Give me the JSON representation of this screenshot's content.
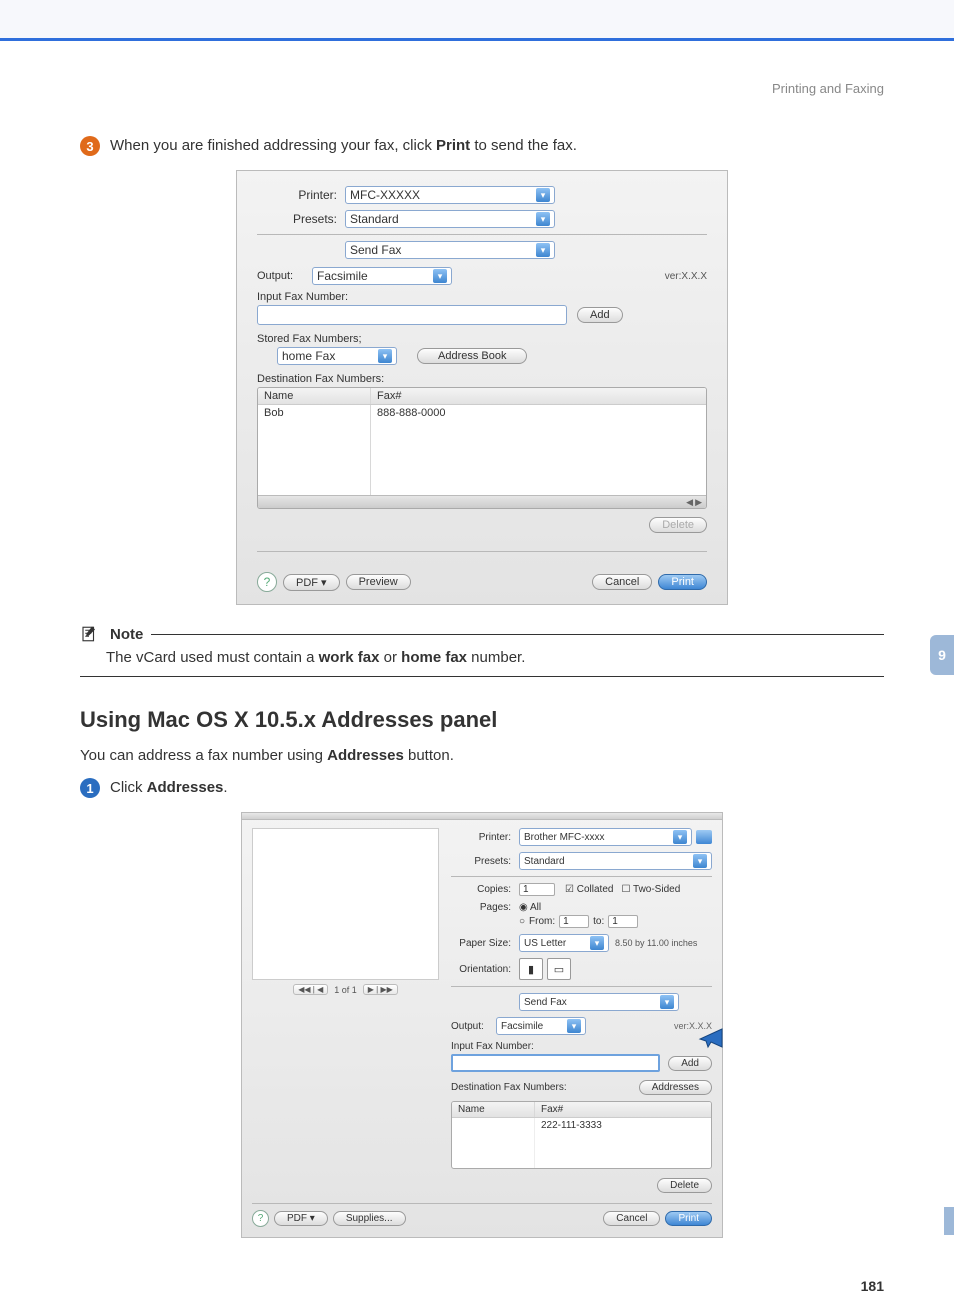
{
  "header": {
    "section": "Printing and Faxing"
  },
  "step3": {
    "num": "3",
    "text_pre": "When you are finished addressing your fax, click ",
    "text_bold": "Print",
    "text_post": " to send the fax."
  },
  "dialog1": {
    "printer_label": "Printer:",
    "printer_value": "MFC-XXXXX",
    "presets_label": "Presets:",
    "presets_value": "Standard",
    "panel_value": "Send Fax",
    "output_label": "Output:",
    "output_value": "Facsimile",
    "version": "ver:X.X.X",
    "input_fax_label": "Input Fax Number:",
    "add_btn": "Add",
    "stored_label": "Stored Fax Numbers;",
    "stored_value": "home Fax",
    "address_btn": "Address Book",
    "dest_label": "Destination Fax Numbers:",
    "col_name": "Name",
    "col_fax": "Fax#",
    "row_name": "Bob",
    "row_fax": "888-888-0000",
    "delete_btn": "Delete",
    "help": "?",
    "pdf_btn": "PDF ▾",
    "preview_btn": "Preview",
    "cancel_btn": "Cancel",
    "print_btn": "Print"
  },
  "note": {
    "title": "Note",
    "text_pre": "The vCard used must contain a ",
    "bold1": "work fax",
    "mid": " or ",
    "bold2": "home fax",
    "text_post": " number."
  },
  "heading2": "Using Mac OS X 10.5.x Addresses panel",
  "para2_pre": "You can address a fax number using ",
  "para2_bold": "Addresses",
  "para2_post": " button.",
  "step1": {
    "num": "1",
    "text_pre": "Click ",
    "text_bold": "Addresses",
    "text_post": "."
  },
  "dialog2": {
    "printer_label": "Printer:",
    "printer_value": "Brother MFC-xxxx",
    "presets_label": "Presets:",
    "presets_value": "Standard",
    "copies_label": "Copies:",
    "copies_value": "1",
    "collated": "Collated",
    "twosided": "Two-Sided",
    "pages_label": "Pages:",
    "pages_all": "All",
    "pages_from": "From:",
    "from_val": "1",
    "pages_to": "to:",
    "to_val": "1",
    "paper_label": "Paper Size:",
    "paper_value": "US Letter",
    "paper_dim": "8.50 by 11.00 inches",
    "orient_label": "Orientation:",
    "panel_value": "Send Fax",
    "output_label": "Output:",
    "output_value": "Facsimile",
    "version": "ver:X.X.X",
    "input_fax_label": "Input Fax Number:",
    "add_btn": "Add",
    "dest_label": "Destination Fax Numbers:",
    "addresses_btn": "Addresses",
    "col_name": "Name",
    "col_fax": "Fax#",
    "row_fax": "222-111-3333",
    "delete_btn": "Delete",
    "nav_text": "1 of 1",
    "help": "?",
    "pdf_btn": "PDF ▾",
    "supplies_btn": "Supplies...",
    "cancel_btn": "Cancel",
    "print_btn": "Print"
  },
  "side_tab": "9",
  "page_number": "181"
}
